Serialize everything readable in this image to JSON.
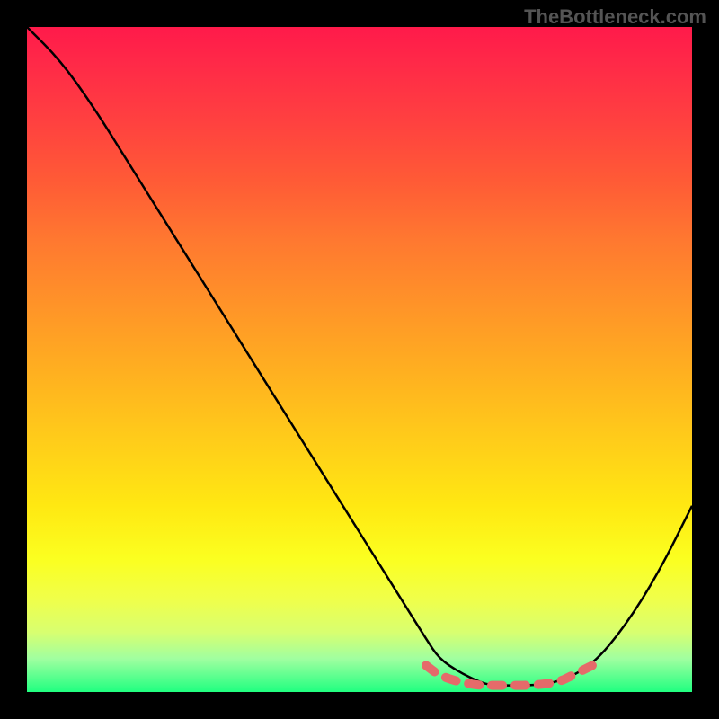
{
  "watermark": "TheBottleneck.com",
  "chart_data": {
    "type": "line",
    "title": "",
    "xlabel": "",
    "ylabel": "",
    "xlim": [
      0,
      100
    ],
    "ylim": [
      0,
      100
    ],
    "series": [
      {
        "name": "bottleneck-curve",
        "x": [
          0,
          5,
          10,
          15,
          20,
          25,
          30,
          35,
          40,
          45,
          50,
          55,
          60,
          62,
          65,
          68,
          70,
          73,
          76,
          80,
          85,
          90,
          95,
          100
        ],
        "values": [
          100,
          95,
          88,
          80,
          72,
          64,
          56,
          48,
          40,
          32,
          24,
          16,
          8,
          5,
          3,
          1.5,
          1,
          1,
          1,
          1.5,
          4,
          10,
          18,
          28
        ]
      },
      {
        "name": "optimal-zone",
        "x": [
          60,
          62,
          65,
          68,
          70,
          73,
          76,
          80,
          82,
          85
        ],
        "values": [
          4,
          2.5,
          1.5,
          1,
          1,
          1,
          1,
          1.5,
          2.5,
          4
        ]
      }
    ],
    "colors": {
      "curve": "#000000",
      "optimal_zone": "#e56a6a",
      "gradient_top": "#ff1a4a",
      "gradient_bottom": "#20ff80"
    }
  }
}
